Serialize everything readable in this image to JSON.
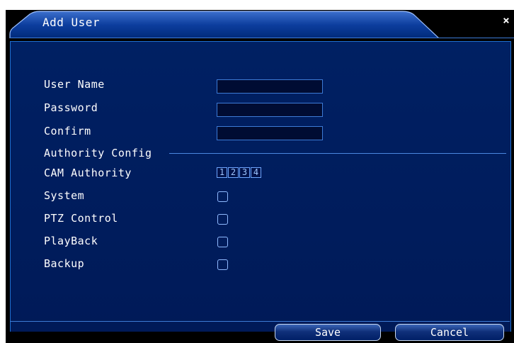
{
  "dialog": {
    "title": "Add User",
    "close_glyph": "×"
  },
  "form": {
    "user_name_label": "User Name",
    "password_label": "Password",
    "confirm_label": "Confirm",
    "user_name_value": "",
    "password_value": "",
    "confirm_value": "",
    "authority_section_label": "Authority Config",
    "cam_authority_label": "CAM Authority",
    "cams": [
      "1",
      "2",
      "3",
      "4"
    ],
    "permissions": [
      {
        "label": "System",
        "checked": false
      },
      {
        "label": "PTZ Control",
        "checked": false
      },
      {
        "label": "PlayBack",
        "checked": false
      },
      {
        "label": "Backup",
        "checked": false
      }
    ]
  },
  "buttons": {
    "save_label": "Save",
    "cancel_label": "Cancel"
  },
  "colors": {
    "panel_bg": "#001a58",
    "accent": "#3d7bd6",
    "text": "#ffffff"
  }
}
